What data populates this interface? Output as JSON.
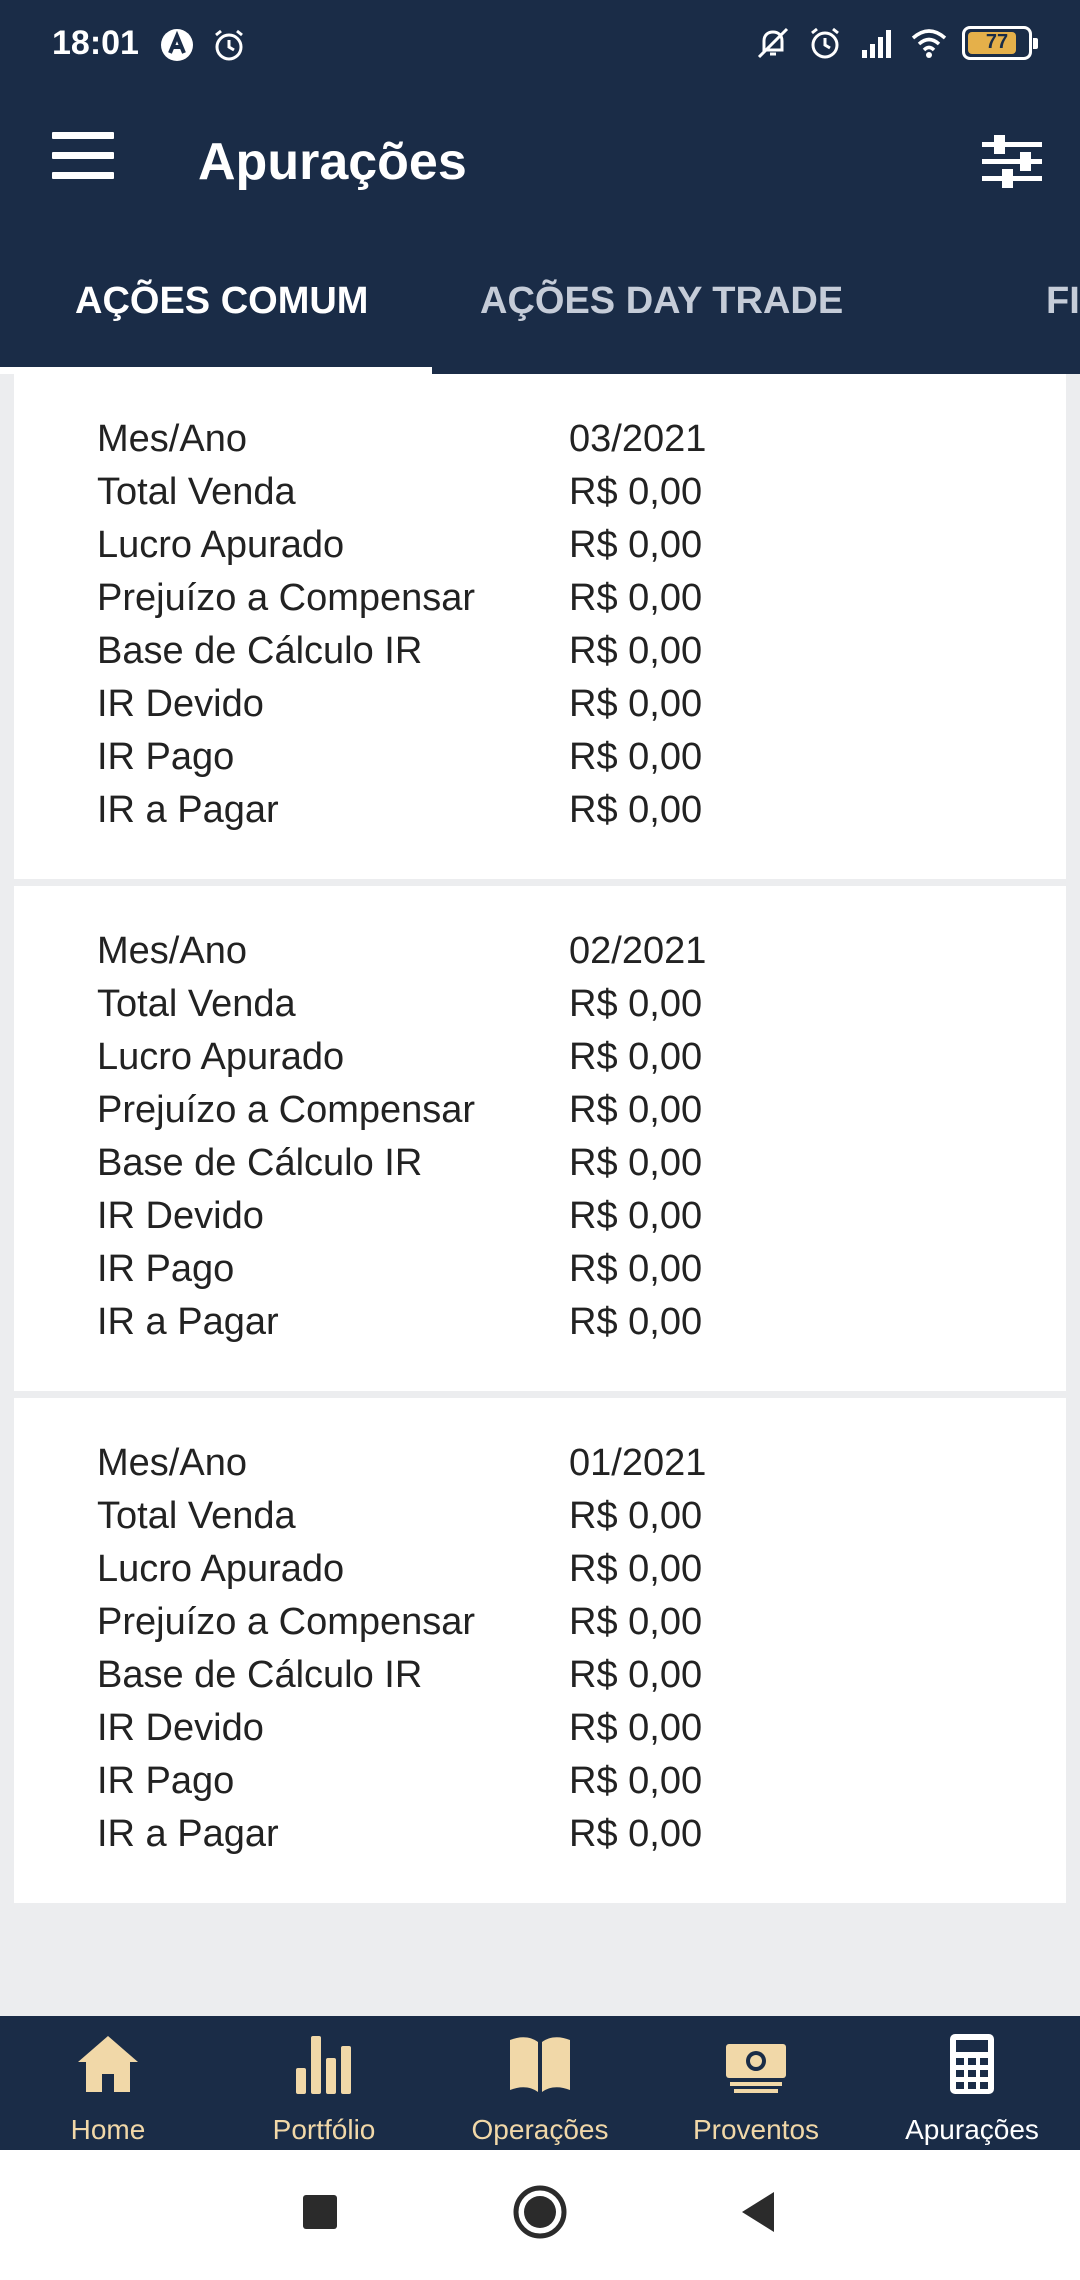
{
  "status_bar": {
    "time": "18:01",
    "battery": "77",
    "left_icons": [
      "app-notification-icon",
      "alarm-icon"
    ],
    "right_icons": [
      "mute-icon",
      "alarm-icon",
      "signal-icon",
      "wifi-icon",
      "battery-icon"
    ]
  },
  "header": {
    "title": "Apurações",
    "menu_icon": "hamburger-menu-icon",
    "filter_icon": "sliders-icon"
  },
  "tabs": [
    {
      "label": "AÇÕES COMUM",
      "active": true
    },
    {
      "label": "AÇÕES DAY TRADE",
      "active": false
    },
    {
      "label": "FI",
      "active": false
    }
  ],
  "labels": {
    "month_year": "Mes/Ano",
    "total_sales": "Total Venda",
    "profit": "Lucro Apurado",
    "loss_to_offset": "Prejuízo a Compensar",
    "tax_base": "Base de Cálculo IR",
    "tax_due": "IR Devido",
    "tax_paid": "IR Pago",
    "tax_payable": "IR a Pagar"
  },
  "cards": [
    {
      "month_year": "03/2021",
      "total_sales": "R$ 0,00",
      "profit": "R$ 0,00",
      "loss_to_offset": "R$ 0,00",
      "tax_base": "R$ 0,00",
      "tax_due": "R$ 0,00",
      "tax_paid": "R$ 0,00",
      "tax_payable": "R$ 0,00"
    },
    {
      "month_year": "02/2021",
      "total_sales": "R$ 0,00",
      "profit": "R$ 0,00",
      "loss_to_offset": "R$ 0,00",
      "tax_base": "R$ 0,00",
      "tax_due": "R$ 0,00",
      "tax_paid": "R$ 0,00",
      "tax_payable": "R$ 0,00"
    },
    {
      "month_year": "01/2021",
      "total_sales": "R$ 0,00",
      "profit": "R$ 0,00",
      "loss_to_offset": "R$ 0,00",
      "tax_base": "R$ 0,00",
      "tax_due": "R$ 0,00",
      "tax_paid": "R$ 0,00",
      "tax_payable": "R$ 0,00"
    }
  ],
  "bottom_nav": [
    {
      "label": "Home",
      "icon": "home-icon",
      "active": false
    },
    {
      "label": "Portfólio",
      "icon": "bar-chart-icon",
      "active": false
    },
    {
      "label": "Operações",
      "icon": "book-icon",
      "active": false
    },
    {
      "label": "Proventos",
      "icon": "money-icon",
      "active": false
    },
    {
      "label": "Apurações",
      "icon": "calculator-icon",
      "active": true
    }
  ],
  "colors": {
    "primary": "#1a2c47",
    "nav_icon": "#f1d8a8",
    "battery": "#e5b04a",
    "background": "#ecedef"
  },
  "system_nav": [
    "recents-icon",
    "home-circle-icon",
    "back-icon"
  ]
}
